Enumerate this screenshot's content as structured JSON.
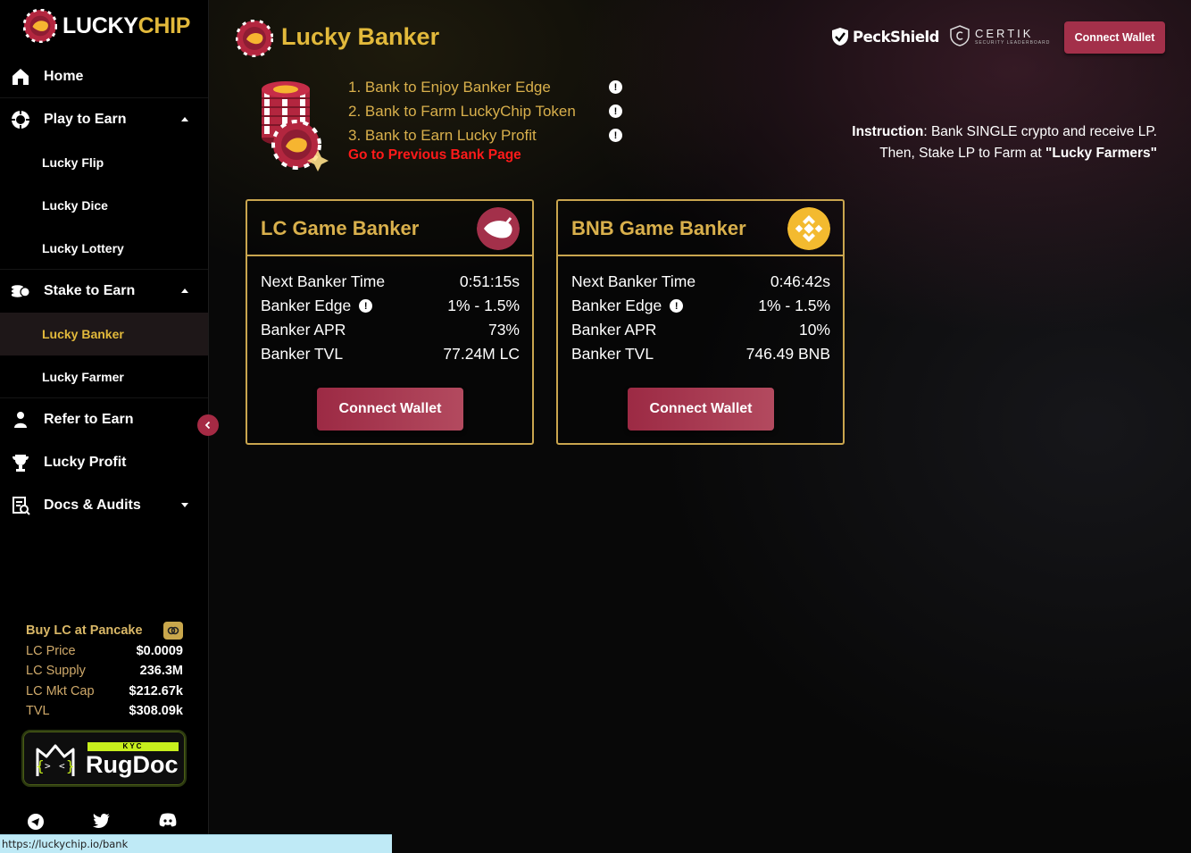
{
  "brand": {
    "part1": "LUCKY",
    "part2": "CHIP"
  },
  "sidebar": {
    "items": [
      {
        "label": "Home"
      },
      {
        "label": "Play to Earn"
      },
      {
        "label": "Stake to Earn"
      },
      {
        "label": "Refer to Earn"
      },
      {
        "label": "Lucky Profit"
      },
      {
        "label": "Docs & Audits"
      }
    ],
    "play_sub": [
      "Lucky Flip",
      "Lucky Dice",
      "Lucky Lottery"
    ],
    "stake_sub": [
      "Lucky Banker",
      "Lucky Farmer"
    ]
  },
  "stats": {
    "buy_link": "Buy LC at Pancake",
    "rows": [
      {
        "k": "LC Price",
        "v": "$0.0009"
      },
      {
        "k": "LC Supply",
        "v": "236.3M"
      },
      {
        "k": "LC Mkt Cap",
        "v": "$212.67k"
      },
      {
        "k": "TVL",
        "v": "$308.09k"
      }
    ]
  },
  "rugdoc": {
    "kyc": "KYC",
    "name": "RugDoc"
  },
  "status_url": "https://luckychip.io/bank",
  "header": {
    "title": "Lucky Banker",
    "peckshield": "PeckShield",
    "certik": "CERTIK",
    "certik_sub": "SECURITY LEADERBOARD",
    "connect_label": "Connect Wallet"
  },
  "steps": [
    "1. Bank to Enjoy Banker Edge",
    "2. Bank to Farm LuckyChip Token",
    "3. Bank to Earn Lucky Profit"
  ],
  "prev_link": "Go to Previous Bank Page",
  "instruction": {
    "label": "Instruction",
    "line1": ": Bank SINGLE crypto and receive LP.",
    "line2": "Then, Stake LP to Farm at ",
    "farm_name": "\"Lucky Farmers\""
  },
  "cards": [
    {
      "title": "LC Game Banker",
      "rows": [
        {
          "k": "Next Banker Time",
          "v": "0:51:15s"
        },
        {
          "k": "Banker Edge",
          "v": "1% - 1.5%"
        },
        {
          "k": "Banker APR",
          "v": "73%"
        },
        {
          "k": "Banker TVL",
          "v": "77.24M LC"
        }
      ],
      "button": "Connect Wallet",
      "coin_color": "#a3304a"
    },
    {
      "title": "BNB Game Banker",
      "rows": [
        {
          "k": "Next Banker Time",
          "v": "0:46:42s"
        },
        {
          "k": "Banker Edge",
          "v": "1% - 1.5%"
        },
        {
          "k": "Banker APR",
          "v": "10%"
        },
        {
          "k": "Banker TVL",
          "v": "746.49 BNB"
        }
      ],
      "button": "Connect Wallet",
      "coin_color": "#f3ba2f"
    }
  ],
  "info_glyph": "!",
  "colors": {
    "gold": "#e2b93b",
    "accent": "#a3304a",
    "link_red": "#ff1a1a"
  }
}
